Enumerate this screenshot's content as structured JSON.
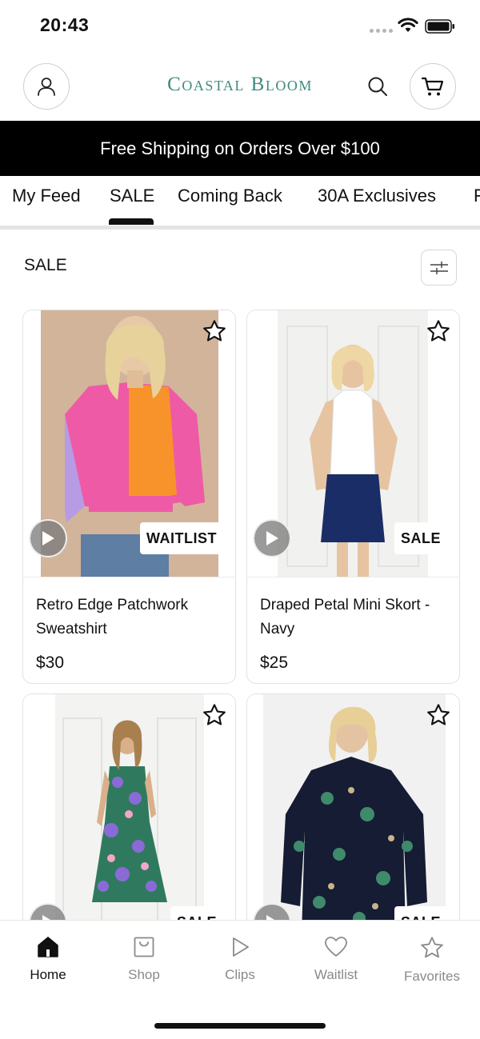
{
  "status_bar": {
    "time": "20:43"
  },
  "header": {
    "brand": "Coastal Bloom"
  },
  "promo": {
    "text": "Free Shipping on Orders Over $100"
  },
  "tabs": [
    {
      "label": "My Feed",
      "active": false
    },
    {
      "label": "SALE",
      "active": true
    },
    {
      "label": "Coming Back",
      "active": false
    },
    {
      "label": "30A Exclusives",
      "active": false
    },
    {
      "label": "F",
      "active": false
    }
  ],
  "section": {
    "title": "SALE"
  },
  "products": [
    {
      "name": "Retro Edge Patchwork Sweatshirt",
      "price": "$30",
      "badge": "WAITLIST"
    },
    {
      "name": "Draped Petal Mini Skort - Navy",
      "price": "$25",
      "badge": "SALE"
    },
    {
      "name": "",
      "price": "",
      "badge": "SALE"
    },
    {
      "name": "",
      "price": "",
      "badge": "SALE"
    }
  ],
  "bottom_nav": [
    {
      "label": "Home",
      "icon": "home-icon",
      "active": true
    },
    {
      "label": "Shop",
      "icon": "shopping-bag-icon",
      "active": false
    },
    {
      "label": "Clips",
      "icon": "play-icon",
      "active": false
    },
    {
      "label": "Waitlist",
      "icon": "heart-icon",
      "active": false
    },
    {
      "label": "Favorites",
      "icon": "star-icon",
      "active": false
    }
  ],
  "colors": {
    "brand": "#3f8a80",
    "banner_bg": "#000000",
    "active": "#111111",
    "inactive": "#8a8a8a"
  }
}
